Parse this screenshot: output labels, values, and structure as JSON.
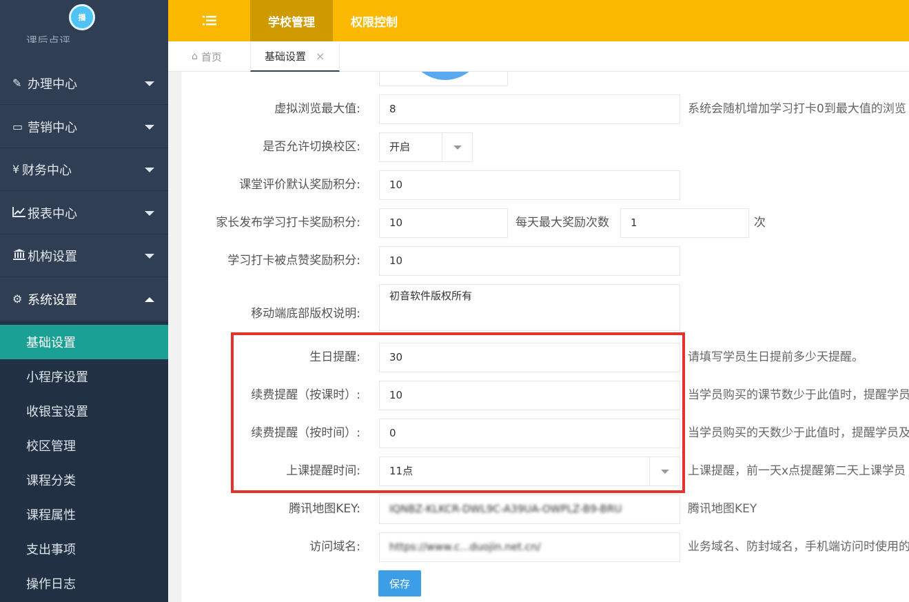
{
  "sidebar": {
    "logo_text": "播",
    "ghost_item": "课后点评",
    "menus": [
      {
        "label": "办理中心",
        "icon": "edit-icon"
      },
      {
        "label": "营销中心",
        "icon": "laptop-icon"
      },
      {
        "label": "财务中心",
        "icon": "yen-icon"
      },
      {
        "label": "报表中心",
        "icon": "chart-icon"
      },
      {
        "label": "机构设置",
        "icon": "bank-icon"
      },
      {
        "label": "系统设置",
        "icon": "gears-icon"
      }
    ],
    "submenu": [
      {
        "label": "基础设置",
        "active": true
      },
      {
        "label": "小程序设置"
      },
      {
        "label": "收银宝设置"
      },
      {
        "label": "校区管理"
      },
      {
        "label": "课程分类"
      },
      {
        "label": "课程属性"
      },
      {
        "label": "支出事项"
      },
      {
        "label": "操作日志"
      }
    ]
  },
  "topbar": {
    "menu_icon": "list-icon",
    "items": [
      {
        "label": "学校管理",
        "active": true
      },
      {
        "label": "权限控制"
      }
    ],
    "accent_color": "#fbb800",
    "active_color": "#cf9a00"
  },
  "tabs": [
    {
      "label": "首页",
      "icon": "home-icon"
    },
    {
      "label": "基础设置",
      "close": "×",
      "active": true
    }
  ],
  "form": {
    "virtual_browse": {
      "label": "虚拟浏览最大值:",
      "value": "8",
      "hint": "系统会随机增加学习打卡0到最大值的浏览"
    },
    "switch_campus": {
      "label": "是否允许切换校区:",
      "value": "开启"
    },
    "class_eval_points": {
      "label": "课堂评价默认奖励积分:",
      "value": "10"
    },
    "parent_post_points": {
      "label": "家长发布学习打卡奖励积分:",
      "value": "10",
      "max_label": "每天最大奖励次数",
      "max_value": "1",
      "unit": "次"
    },
    "like_points": {
      "label": "学习打卡被点赞奖励积分:",
      "value": "10"
    },
    "copyright": {
      "label": "移动端底部版权说明:",
      "value": "初音软件版权所有"
    },
    "birthday": {
      "label": "生日提醒:",
      "value": "30",
      "hint": "请填写学员生日提前多少天提醒。"
    },
    "renew_by_lesson": {
      "label": "续费提醒（按课时）:",
      "value": "10",
      "hint": "当学员购买的课节数少于此值时，提醒学员"
    },
    "renew_by_time": {
      "label": "续费提醒（按时间）:",
      "value": "0",
      "hint": "当学员购买的天数少于此值时，提醒学员及"
    },
    "class_remind_time": {
      "label": "上课提醒时间:",
      "value": "11点",
      "hint": "上课提醒，前一天x点提醒第二天上课学员"
    },
    "map_key": {
      "label": "腾讯地图KEY:",
      "value": "IQNBZ-KLKCR-DWL9C-A39UA-OWPLZ-B9-BRU",
      "hint": "腾讯地图KEY"
    },
    "domain": {
      "label": "访问域名:",
      "value": "https://www.c...duojin.net.cn/",
      "hint": "业务域名、防封域名，手机端访问时使用的"
    },
    "save_label": "保存"
  },
  "colors": {
    "sidebar_bg": "#2f3e53",
    "active_sub": "#1aa094",
    "highlight_box": "#e5322d",
    "save_button": "#3b9ee6"
  }
}
